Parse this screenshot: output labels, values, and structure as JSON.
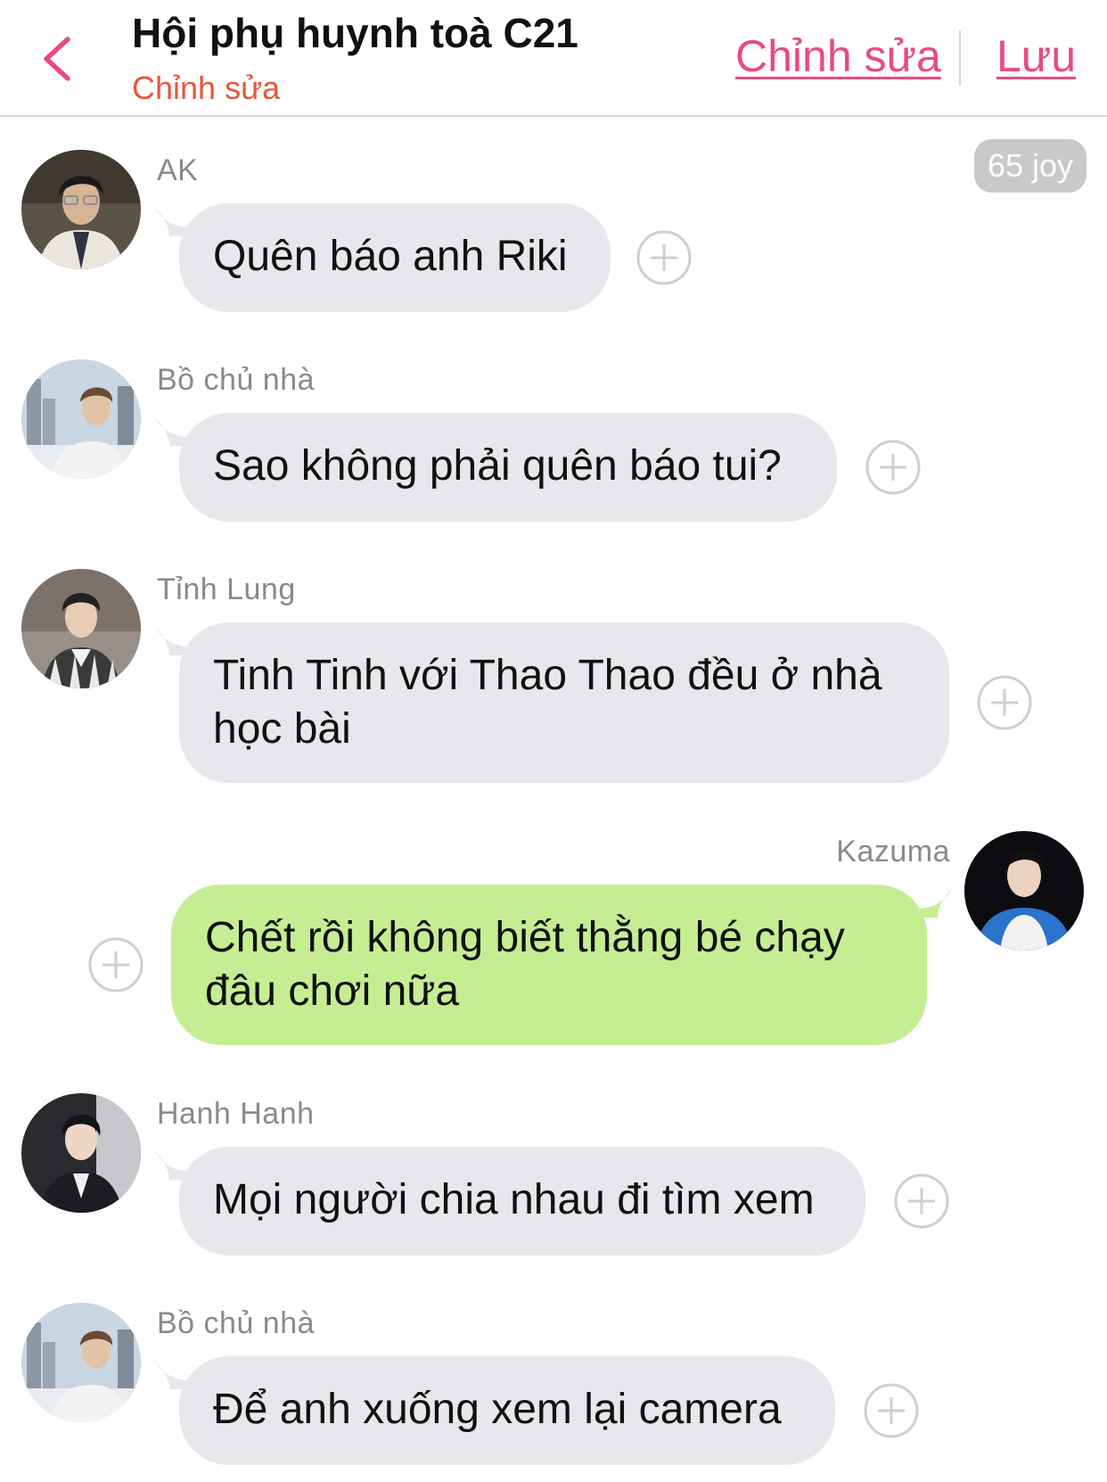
{
  "header": {
    "title": "Hội phụ huynh toà C21",
    "subtitle": "Chỉnh sửa",
    "edit_label": "Chỉnh sửa",
    "save_label": "Lưu"
  },
  "joy_badge": "65 joy",
  "messages": [
    {
      "sender": "AK",
      "text": "Quên báo anh Riki",
      "direction": "incoming"
    },
    {
      "sender": "Bồ chủ nhà",
      "text": "Sao không phải quên báo tui?",
      "direction": "incoming"
    },
    {
      "sender": "Tỉnh Lung",
      "text": "Tinh Tinh với Thao Thao đều ở nhà học bài",
      "direction": "incoming"
    },
    {
      "sender": "Kazuma",
      "text": "Chết rồi không biết thằng bé chạy đâu chơi nữa",
      "direction": "outgoing"
    },
    {
      "sender": "Hanh Hanh",
      "text": "Mọi người chia nhau đi tìm xem",
      "direction": "incoming"
    },
    {
      "sender": "Bồ chủ nhà",
      "text": "Để anh xuống xem lại camera",
      "direction": "incoming"
    }
  ],
  "colors": {
    "accent_pink": "#e84c7d",
    "subtitle_red": "#e8563a",
    "incoming_bubble": "#e6e8eb",
    "outgoing_bubble": "#c5ee93",
    "joy_badge_bg": "#c9c9c9"
  },
  "icons": {
    "back": "chevron-left-icon",
    "add_reaction": "plus-circle-icon"
  }
}
